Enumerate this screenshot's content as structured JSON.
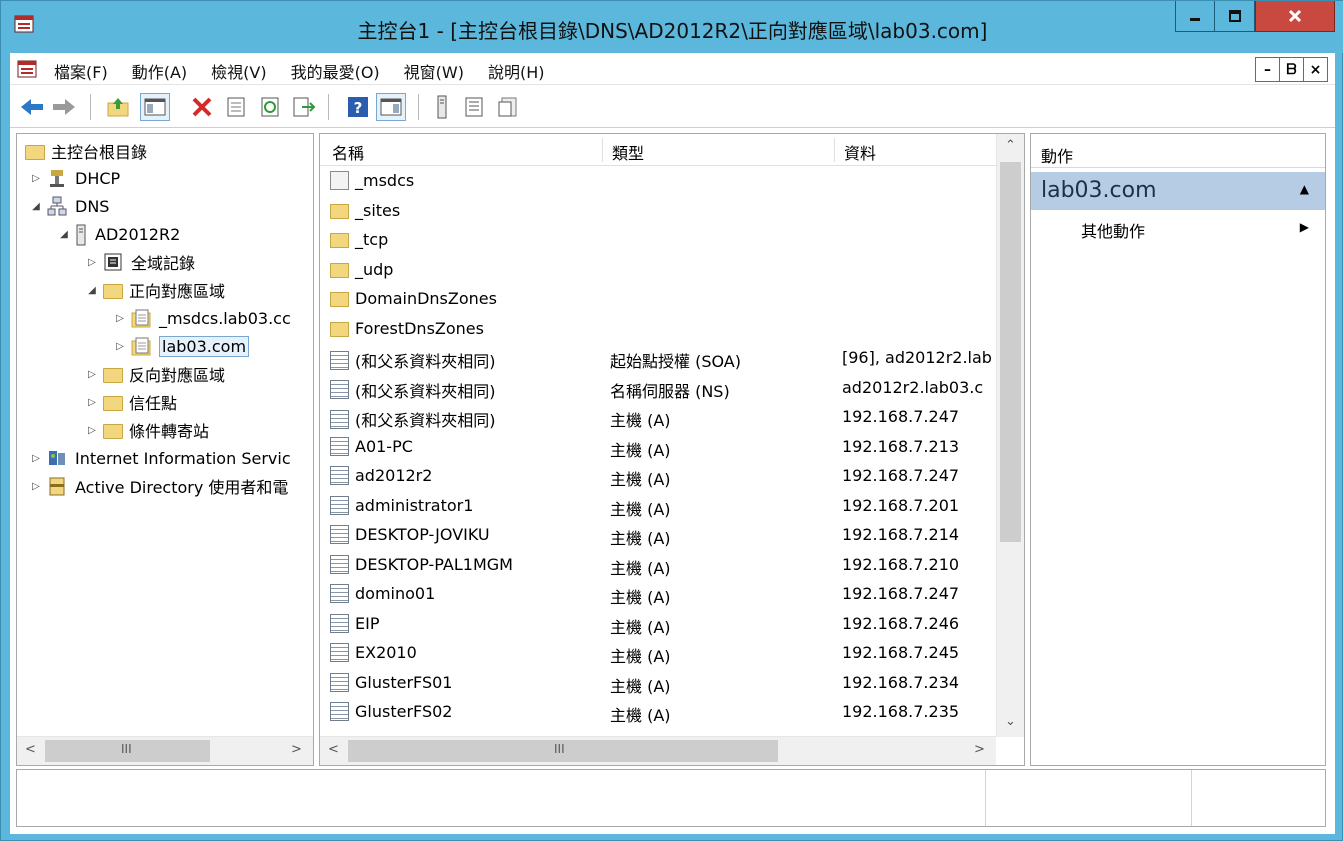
{
  "window": {
    "title": "主控台1 - [主控台根目錄\\DNS\\AD2012R2\\正向對應區域\\lab03.com]",
    "min_label": "—",
    "max_label": "□",
    "close_label": "X"
  },
  "menubar": {
    "items": [
      "檔案(F)",
      "動作(A)",
      "檢視(V)",
      "我的最愛(O)",
      "視窗(W)",
      "說明(H)"
    ],
    "mdi_min": "–",
    "mdi_restore": "ᗷ",
    "mdi_close": "×"
  },
  "toolbar": {
    "icons": [
      "back-icon",
      "forward-icon",
      "up-folder-icon",
      "show-hide-tree-icon",
      "delete-icon",
      "properties-icon",
      "refresh-icon",
      "export-list-icon",
      "help-icon",
      "show-hide-action-pane-icon",
      "server-icon",
      "list-view-icon",
      "detail-view-icon"
    ]
  },
  "tree": {
    "items": [
      {
        "label": "主控台根目錄",
        "icon": "folder-icon"
      },
      {
        "label": "DHCP",
        "icon": "dhcp-icon"
      },
      {
        "label": "DNS",
        "icon": "dns-icon"
      },
      {
        "label": "AD2012R2",
        "icon": "server-icon"
      },
      {
        "label": "全域記錄",
        "icon": "log-icon"
      },
      {
        "label": "正向對應區域",
        "icon": "folder-icon"
      },
      {
        "label": "_msdcs.lab03.cc",
        "icon": "zone-icon"
      },
      {
        "label": "lab03.com",
        "icon": "zone-icon"
      },
      {
        "label": "反向對應區域",
        "icon": "folder-icon"
      },
      {
        "label": "信任點",
        "icon": "folder-icon"
      },
      {
        "label": "條件轉寄站",
        "icon": "folder-icon"
      },
      {
        "label": "Internet Information Servic",
        "icon": "iis-icon"
      },
      {
        "label": "Active Directory 使用者和電",
        "icon": "ad-icon"
      }
    ]
  },
  "list": {
    "columns": [
      "名稱",
      "類型",
      "資料"
    ],
    "rows": [
      {
        "name": "_msdcs",
        "type": "",
        "data": "",
        "icon": "zone-icon"
      },
      {
        "name": "_sites",
        "type": "",
        "data": "",
        "icon": "folder-icon"
      },
      {
        "name": "_tcp",
        "type": "",
        "data": "",
        "icon": "folder-icon"
      },
      {
        "name": "_udp",
        "type": "",
        "data": "",
        "icon": "folder-icon"
      },
      {
        "name": "DomainDnsZones",
        "type": "",
        "data": "",
        "icon": "folder-icon"
      },
      {
        "name": "ForestDnsZones",
        "type": "",
        "data": "",
        "icon": "folder-icon"
      },
      {
        "name": "(和父系資料夾相同)",
        "type": "起始點授權 (SOA)",
        "data": "[96], ad2012r2.lab",
        "icon": "record-icon"
      },
      {
        "name": "(和父系資料夾相同)",
        "type": "名稱伺服器 (NS)",
        "data": "ad2012r2.lab03.c",
        "icon": "record-icon"
      },
      {
        "name": "(和父系資料夾相同)",
        "type": "主機 (A)",
        "data": "192.168.7.247",
        "icon": "record-icon"
      },
      {
        "name": "A01-PC",
        "type": "主機 (A)",
        "data": "192.168.7.213",
        "icon": "record-icon"
      },
      {
        "name": "ad2012r2",
        "type": "主機 (A)",
        "data": "192.168.7.247",
        "icon": "record-icon"
      },
      {
        "name": "administrator1",
        "type": "主機 (A)",
        "data": "192.168.7.201",
        "icon": "record-icon"
      },
      {
        "name": "DESKTOP-JOVIKU",
        "type": "主機 (A)",
        "data": "192.168.7.214",
        "icon": "record-icon"
      },
      {
        "name": "DESKTOP-PAL1MGM",
        "type": "主機 (A)",
        "data": "192.168.7.210",
        "icon": "record-icon"
      },
      {
        "name": "domino01",
        "type": "主機 (A)",
        "data": "192.168.7.247",
        "icon": "record-icon"
      },
      {
        "name": "EIP",
        "type": "主機 (A)",
        "data": "192.168.7.246",
        "icon": "record-icon"
      },
      {
        "name": "EX2010",
        "type": "主機 (A)",
        "data": "192.168.7.245",
        "icon": "record-icon"
      },
      {
        "name": "GlusterFS01",
        "type": "主機 (A)",
        "data": "192.168.7.234",
        "icon": "record-icon"
      },
      {
        "name": "GlusterFS02",
        "type": "主機 (A)",
        "data": "192.168.7.235",
        "icon": "record-icon"
      }
    ],
    "scroll_mid": "III",
    "col_menu": "≡"
  },
  "actions": {
    "title": "動作",
    "group": "lab03.com",
    "item": "其他動作",
    "collapse_glyph": "▲",
    "submenu_glyph": "▶"
  },
  "tree_scroll_mid": "III"
}
